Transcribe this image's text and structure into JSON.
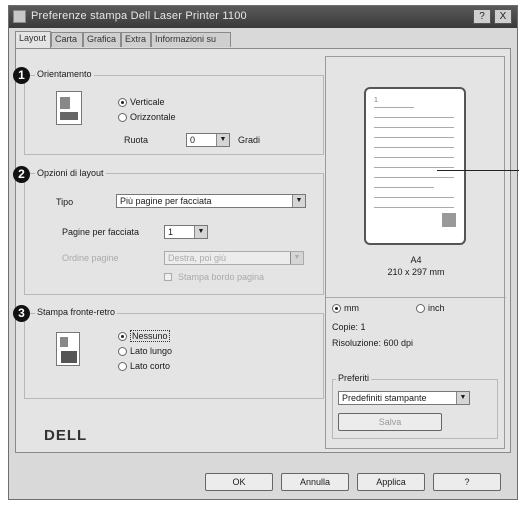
{
  "window": {
    "title": "Preferenze stampa Dell Laser Printer 1100",
    "help_label": "?",
    "close_label": "X"
  },
  "tabs": [
    "Layout",
    "Carta",
    "Grafica",
    "Extra",
    "Informazioni su"
  ],
  "orientation": {
    "number": "1",
    "title": "Orientamento",
    "options": [
      "Verticale",
      "Orizzontale"
    ],
    "selected": "Verticale",
    "rotate_label": "Ruota",
    "rotate_value": "0",
    "rotate_unit": "Gradi"
  },
  "layout_options": {
    "number": "2",
    "title": "Opzioni di layout",
    "type_label": "Tipo",
    "type_value": "Più pagine per facciata",
    "pages_label": "Pagine per facciata",
    "pages_value": "1",
    "order_label": "Ordine pagine",
    "order_value": "Destra, poi giù",
    "border_label": "Stampa bordo pagina"
  },
  "duplex": {
    "number": "3",
    "title": "Stampa fronte-retro",
    "options": [
      "Nessuno",
      "Lato lungo",
      "Lato corto"
    ],
    "selected": "Nessuno"
  },
  "brand": {
    "logo": "DELL"
  },
  "preview": {
    "paper_size": "A4",
    "paper_dims": "210 x 297 mm",
    "units": [
      "mm",
      "inch"
    ],
    "unit_selected": "mm",
    "copies": "Copie: 1",
    "resolution": "Risoluzione: 600 dpi"
  },
  "favorites": {
    "title": "Preferiti",
    "value": "Predefiniti stampante",
    "save_label": "Salva"
  },
  "footer": {
    "ok": "OK",
    "cancel": "Annulla",
    "apply": "Applica",
    "help": "?"
  }
}
